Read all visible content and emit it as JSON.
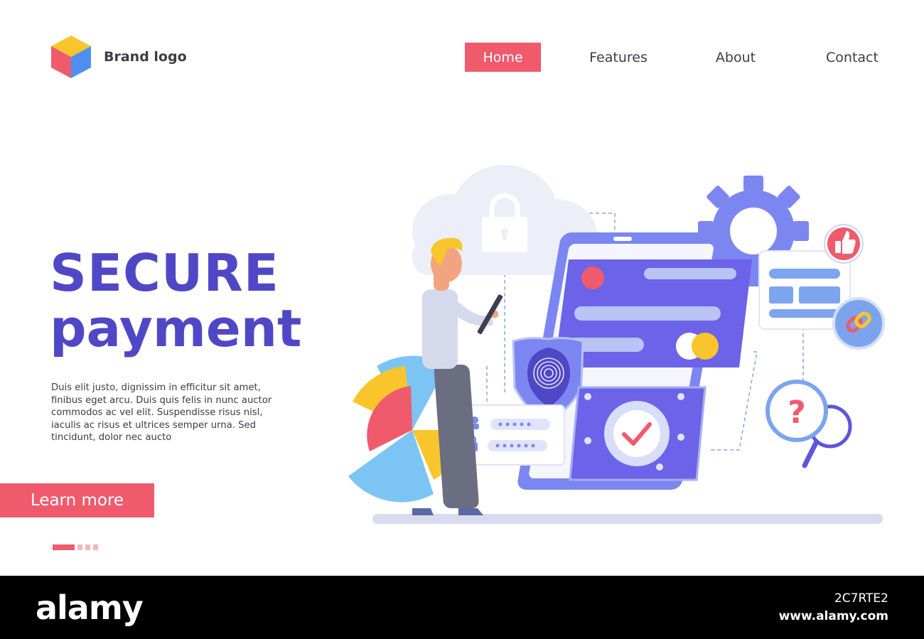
{
  "header": {
    "brand_name": "Brand logo",
    "logo_icon": "cube-icon",
    "nav": [
      {
        "label": "Home",
        "active": true
      },
      {
        "label": "Features",
        "active": false
      },
      {
        "label": "About",
        "active": false
      },
      {
        "label": "Contact",
        "active": false
      }
    ]
  },
  "hero": {
    "title_line1": "SECURE",
    "title_line2": "payment",
    "description": "Duis elit justo, dignissim in efficitur sit amet, finibus eget arcu. Duis quis felis in nunc auctor commodos ac vel elit. Suspendisse risus nisl, iaculis ac risus et ultrices semper urna. Sed tincidunt, dolor nec aucto",
    "cta_label": "Learn more",
    "pagination": {
      "total": 4,
      "active": 1
    }
  },
  "illustration": {
    "icons": [
      "cloud-lock-icon",
      "gear-icon",
      "thumbs-up-icon",
      "link-icon",
      "question-search-icon",
      "fingerprint-shield-icon",
      "checkmark-icon",
      "password-form-icon",
      "phone-icon",
      "credit-card-icon",
      "person-figure"
    ]
  },
  "footer": {
    "brand": "alamy",
    "image_id": "2C7RTE2",
    "url": "www.alamy.com"
  },
  "colors": {
    "accent": "#ef5b6c",
    "primary": "#5047c6",
    "text": "#3c3c46",
    "light_purple": "#6c63e8"
  }
}
